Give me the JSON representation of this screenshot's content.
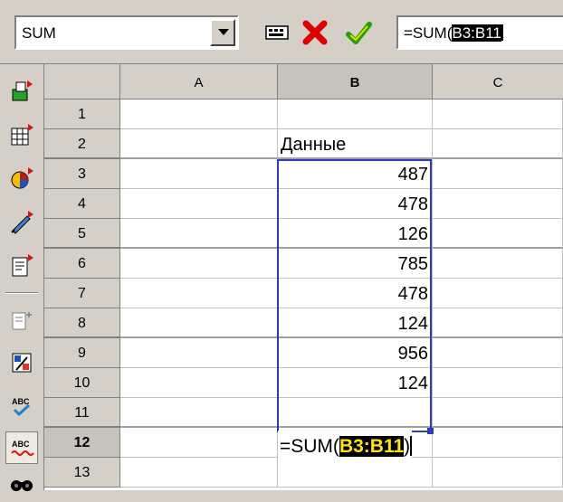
{
  "formula_bar": {
    "name_box": "SUM",
    "formula_prefix": "=SUM(",
    "formula_selected": "B3:B11",
    "icons": [
      "function-autopilot-icon",
      "cancel-icon",
      "accept-icon"
    ]
  },
  "left_toolbar": {
    "icons": [
      "insert-icon",
      "insert-cell-icon",
      "insert-object-icon",
      "show-draw-icon",
      "edit-file-icon",
      "insert-field-icon",
      "autoformat-icon",
      "spellcheck-icon",
      "autospellcheck-icon",
      "find-icon"
    ]
  },
  "grid": {
    "columns": [
      "A",
      "B",
      "C"
    ],
    "active_column": "B",
    "rows": [
      "1",
      "2",
      "3",
      "4",
      "5",
      "6",
      "7",
      "8",
      "9",
      "10",
      "11",
      "12",
      "13"
    ],
    "active_row": "12",
    "cells": {
      "B2": "Данные",
      "B3": "487",
      "B4": "478",
      "B5": "126",
      "B6": "785",
      "B7": "478",
      "B8": "124",
      "B9": "956",
      "B10": "124"
    },
    "editing_cell": {
      "ref": "B12",
      "prefix": "=SUM(",
      "reference": "B3:B11",
      "suffix": ")"
    }
  },
  "colors": {
    "selection_border": "#2c3cb4",
    "reference_highlight_bg": "#000000",
    "reference_highlight_text": "#ffe600",
    "toolbar_bg": "#d4d0c8"
  }
}
